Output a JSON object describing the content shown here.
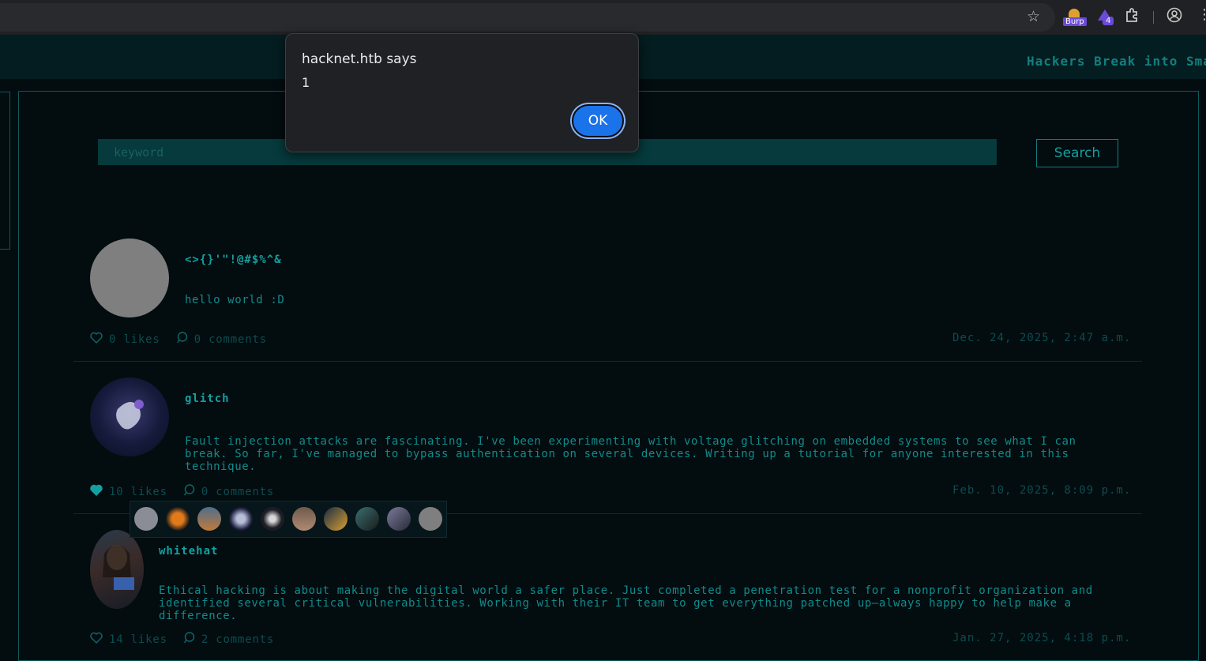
{
  "browser": {
    "extensions": {
      "burp_label": "Burp",
      "wizard_badge": "4"
    }
  },
  "header": {
    "ticker": "Hackers Break into Sma"
  },
  "search": {
    "placeholder": "keyword",
    "button_label": "Search"
  },
  "posts": [
    {
      "author": "<>{}'\"!@#$%^&",
      "content": "hello world :D",
      "likes": "0 likes",
      "comments": "0 comments",
      "date": "Dec. 24, 2025, 2:47 a.m.",
      "liked": false
    },
    {
      "author": "glitch",
      "content": "Fault injection attacks are fascinating. I've been experimenting with voltage glitching on embedded systems to see what I can break. So far, I've managed to bypass authentication on several devices. Writing up a tutorial for anyone interested in this technique.",
      "likes": "10 likes",
      "comments": "0 comments",
      "date": "Feb. 10, 2025, 8:09 p.m.",
      "liked": true
    },
    {
      "author": "whitehat",
      "content": "Ethical hacking is about making the digital world a safer place. Just completed a penetration test for a nonprofit organization and identified several critical vulnerabilities. Working with their IT team to get everything patched up—always happy to help make a difference.",
      "likes": "14 likes",
      "comments": "2 comments",
      "date": "Jan. 27, 2025, 4:18 p.m.",
      "liked": false
    }
  ],
  "dialog": {
    "title": "hacknet.htb says",
    "message": "1",
    "ok_label": "OK"
  },
  "colors": {
    "background": "#030c0f",
    "accent": "#13a0a0",
    "dialog_button": "#1a73e8"
  }
}
